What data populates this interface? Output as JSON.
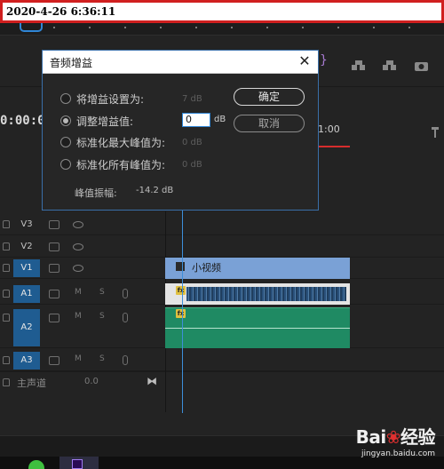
{
  "overlay": {
    "timestamp": "2020-4-26 6:36:11"
  },
  "timeline": {
    "timecode_partial": "0:00:0",
    "ruler_label": "1:00",
    "tracks": [
      {
        "name": "V3",
        "active": false
      },
      {
        "name": "V2",
        "active": false
      },
      {
        "name": "V1",
        "active": true
      },
      {
        "name": "A1",
        "active": true
      },
      {
        "name": "A2",
        "active": true
      },
      {
        "name": "A3",
        "active": true
      }
    ],
    "audio_buttons": {
      "mute": "M",
      "solo": "S"
    },
    "master": {
      "label": "主声道",
      "value": "0.0"
    },
    "clips": {
      "video_label": "小视频",
      "fx": "fx"
    }
  },
  "dialog": {
    "title": "音频增益",
    "close_glyph": "✕",
    "options": [
      {
        "label": "将增益设置为:",
        "value": "7 dB",
        "checked": false
      },
      {
        "label": "调整增益值:",
        "value": "",
        "checked": true
      },
      {
        "label": "标准化最大峰值为:",
        "value": "0 dB",
        "checked": false
      },
      {
        "label": "标准化所有峰值为:",
        "value": "0 dB",
        "checked": false
      }
    ],
    "gain_input_value": "0",
    "gain_unit": "dB",
    "ok_label": "确定",
    "cancel_label": "取消",
    "peak_label": "峰值振幅:",
    "peak_value": "-14.2 dB"
  },
  "watermark": {
    "brand_left": "Bai",
    "brand_paw": "❀",
    "brand_right": "经验",
    "url": "jingyan.baidu.com"
  }
}
